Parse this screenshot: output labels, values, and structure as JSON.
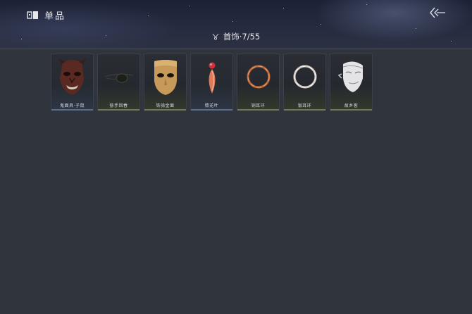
{
  "header": {
    "title": "单品",
    "category_label": "首饰·7/55"
  },
  "items": [
    {
      "name": "鬼面具·子鼠",
      "icon": "demon-mask-icon",
      "tier": "blue"
    },
    {
      "name": "猕手回春",
      "icon": "eye-patch-icon",
      "tier": "green"
    },
    {
      "name": "铁骑金面",
      "icon": "gold-mask-icon",
      "tier": "green"
    },
    {
      "name": "情花叶",
      "icon": "petal-pendant-icon",
      "tier": "blue"
    },
    {
      "name": "铜耳环",
      "icon": "copper-ring-icon",
      "tier": "green"
    },
    {
      "name": "银耳环",
      "icon": "silver-ring-icon",
      "tier": "green"
    },
    {
      "name": "故乡客",
      "icon": "white-mask-icon",
      "tier": "green"
    }
  ],
  "colors": {
    "background": "#30343d",
    "header_top": "#1c2236",
    "tier_green": "#6e7a5a",
    "tier_blue": "#5a6e8c"
  }
}
